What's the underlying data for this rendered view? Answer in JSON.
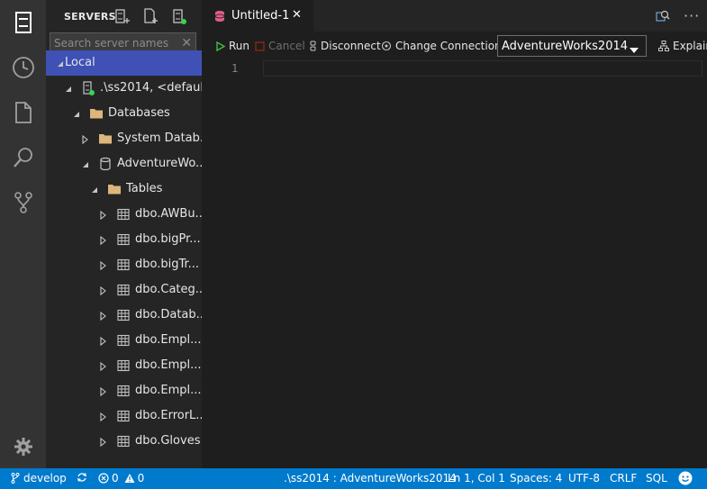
{
  "sidebar": {
    "title": "SERVERS",
    "search_placeholder": "Search server names",
    "tree": [
      {
        "label": "Local",
        "depth": 0,
        "expanded": true,
        "icon": "none",
        "selected": true
      },
      {
        "label": ".\\ss2014, <defaul...",
        "depth": 1,
        "expanded": true,
        "icon": "server-connected-icon"
      },
      {
        "label": "Databases",
        "depth": 2,
        "expanded": true,
        "icon": "folder-icon"
      },
      {
        "label": "System Datab...",
        "depth": 3,
        "expanded": false,
        "icon": "folder-icon"
      },
      {
        "label": "AdventureWo...",
        "depth": 3,
        "expanded": true,
        "icon": "database-icon"
      },
      {
        "label": "Tables",
        "depth": 4,
        "expanded": true,
        "icon": "folder-icon"
      },
      {
        "label": "dbo.AWBu...",
        "depth": 5,
        "expanded": false,
        "icon": "table-icon"
      },
      {
        "label": "dbo.bigPr...",
        "depth": 5,
        "expanded": false,
        "icon": "table-icon"
      },
      {
        "label": "dbo.bigTr...",
        "depth": 5,
        "expanded": false,
        "icon": "table-icon"
      },
      {
        "label": "dbo.Categ...",
        "depth": 5,
        "expanded": false,
        "icon": "table-icon"
      },
      {
        "label": "dbo.Datab...",
        "depth": 5,
        "expanded": false,
        "icon": "table-icon"
      },
      {
        "label": "dbo.Empl...",
        "depth": 5,
        "expanded": false,
        "icon": "table-icon"
      },
      {
        "label": "dbo.Empl...",
        "depth": 5,
        "expanded": false,
        "icon": "table-icon"
      },
      {
        "label": "dbo.Empl...",
        "depth": 5,
        "expanded": false,
        "icon": "table-icon"
      },
      {
        "label": "dbo.ErrorL...",
        "depth": 5,
        "expanded": false,
        "icon": "table-icon"
      },
      {
        "label": "dbo.Gloves",
        "depth": 5,
        "expanded": false,
        "icon": "table-icon"
      }
    ]
  },
  "editor": {
    "tab_title": "Untitled-1",
    "toolbar": {
      "run": "Run",
      "cancel": "Cancel",
      "disconnect": "Disconnect",
      "change_connection": "Change Connection",
      "database": "AdventureWorks2014",
      "explain": "Explain"
    },
    "line_number": "1"
  },
  "statusbar": {
    "branch": "develop",
    "errors": "0",
    "warnings": "0",
    "connection": ".\\ss2014 : AdventureWorks2014",
    "cursor": "Ln 1, Col 1",
    "spaces": "Spaces: 4",
    "encoding": "UTF-8",
    "eol": "CRLF",
    "language": "SQL"
  },
  "colors": {
    "accent": "#007acc",
    "selection": "#3f51b5",
    "run_green": "#3fbf3f",
    "tab_icon": "#e05d8c",
    "connected_green": "#39d353"
  }
}
